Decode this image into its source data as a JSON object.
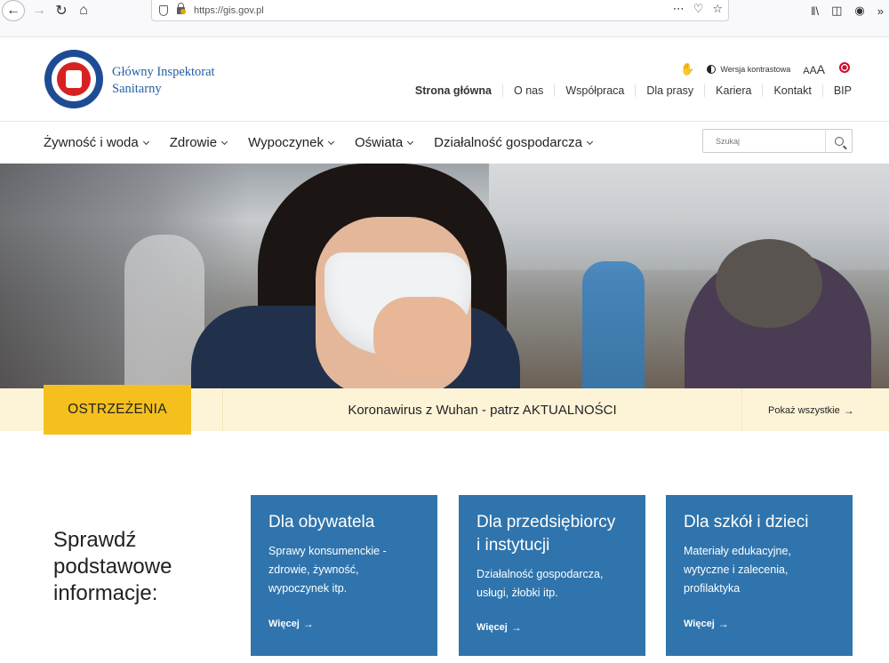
{
  "browser": {
    "url": "https://gis.gov.pl",
    "menu_icon": "⋯"
  },
  "header": {
    "brand_line1": "Główny Inspektorat",
    "brand_line2": "Sanitarny",
    "contrast_label": "Wersja kontrastowa",
    "font_size_labels": [
      "A",
      "A",
      "A"
    ],
    "nav": [
      "Strona główna",
      "O nas",
      "Współpraca",
      "Dla prasy",
      "Kariera",
      "Kontakt",
      "BIP"
    ]
  },
  "menu": {
    "items": [
      "Żywność i woda",
      "Zdrowie",
      "Wypoczynek",
      "Oświata",
      "Działalność gospodarcza"
    ]
  },
  "search": {
    "placeholder": "Szukaj"
  },
  "alert": {
    "badge": "OSTRZEŻENIA",
    "message": "Koronawirus z Wuhan - patrz AKTUALNOŚCI",
    "show_all": "Pokaż wszystkie"
  },
  "info": {
    "intro_line1": "Sprawdź",
    "intro_line2": "podstawowe",
    "intro_line3": "informacje:",
    "cards": [
      {
        "title": "Dla obywatela",
        "desc_line1": "Sprawy konsumenckie -",
        "desc_line2": "zdrowie, żywność,",
        "desc_line3": "wypoczynek itp.",
        "more": "Więcej"
      },
      {
        "title_line1": "Dla przedsiębiorcy",
        "title_line2": "i instytucji",
        "desc_line1": "Działalność gospodarcza,",
        "desc_line2": "usługi, żłobki itp.",
        "more": "Więcej"
      },
      {
        "title": "Dla szkół i dzieci",
        "desc_line1": "Materiały edukacyjne,",
        "desc_line2": "wytyczne i zalecenia,",
        "desc_line3": "profilaktyka",
        "more": "Więcej"
      }
    ]
  },
  "colors": {
    "accent_blue": "#2f74ad",
    "alert_yellow": "#f5c01d",
    "alert_bg": "#fdf4d8",
    "brand_blue": "#2660a4"
  }
}
